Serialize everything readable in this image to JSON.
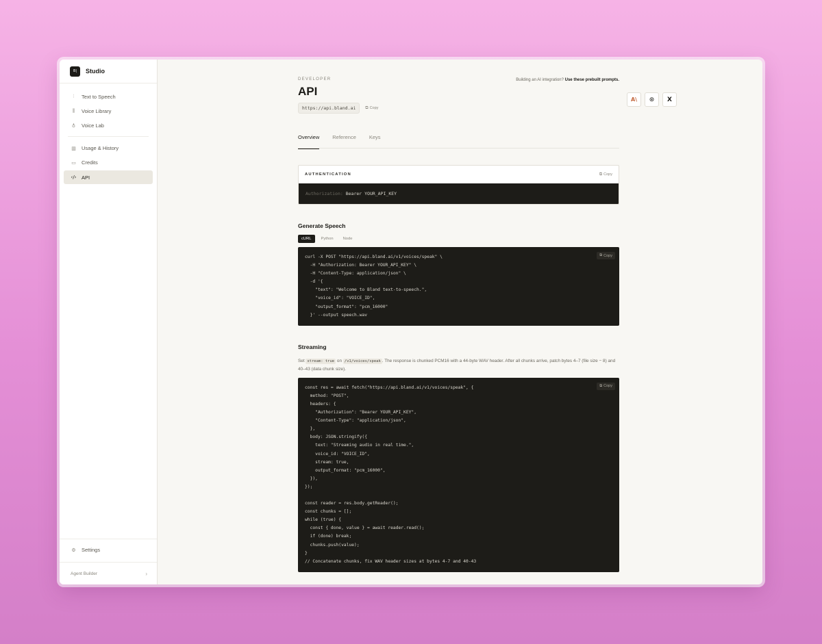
{
  "brand": {
    "name": "Studio",
    "logo_text": "B|"
  },
  "sidebar": {
    "items": [
      {
        "label": "Text to Speech",
        "icon": "waveform-icon"
      },
      {
        "label": "Voice Library",
        "icon": "library-icon"
      },
      {
        "label": "Voice Lab",
        "icon": "mic-icon"
      },
      {
        "label": "Usage & History",
        "icon": "chart-icon"
      },
      {
        "label": "Credits",
        "icon": "card-icon"
      },
      {
        "label": "API",
        "icon": "code-icon"
      }
    ],
    "settings_label": "Settings",
    "agent_builder_label": "Agent Builder"
  },
  "header": {
    "eyebrow": "DEVELOPER",
    "title": "API",
    "base_url": "https://api.bland.ai",
    "copy_label": "Copy"
  },
  "prompts": {
    "text": "Building an AI integration?",
    "link": "Use these prebuilt prompts."
  },
  "tabs": [
    "Overview",
    "Reference",
    "Keys"
  ],
  "auth": {
    "title": "AUTHENTICATION",
    "copy_label": "Copy",
    "key_prefix": "Authorization:",
    "key_value": "Bearer YOUR_API_KEY"
  },
  "generate": {
    "title": "Generate Speech",
    "lang_tabs": [
      "cURL",
      "Python",
      "Node"
    ],
    "copy_label": "Copy",
    "code": "curl -X POST \"https://api.bland.ai/v1/voices/speak\" \\\n  -H \"Authorization: Bearer YOUR_API_KEY\" \\\n  -H \"Content-Type: application/json\" \\\n  -d '{\n    \"text\": \"Welcome to Bland text-to-speech.\",\n    \"voice_id\": \"VOICE_ID\",\n    \"output_format\": \"pcm_16000\"\n  }' --output speech.wav"
  },
  "streaming": {
    "title": "Streaming",
    "desc_1": "Set ",
    "desc_code_1": "stream: true",
    "desc_2": " on ",
    "desc_code_2": "/v1/voices/speak",
    "desc_3": ". The response is chunked PCM16 with a 44-byte WAV header. After all chunks arrive, patch bytes 4–7 (file size − 8) and 40–43 (data chunk size).",
    "copy_label": "Copy",
    "code": "const res = await fetch(\"https://api.bland.ai/v1/voices/speak\", {\n  method: \"POST\",\n  headers: {\n    \"Authorization\": \"Bearer YOUR_API_KEY\",\n    \"Content-Type\": \"application/json\",\n  },\n  body: JSON.stringify({\n    text: \"Streaming audio in real time.\",\n    voice_id: \"VOICE_ID\",\n    stream: true,\n    output_format: \"pcm_16000\",\n  }),\n});\n\nconst reader = res.body.getReader();\nconst chunks = [];\nwhile (true) {\n  const { done, value } = await reader.read();\n  if (done) break;\n  chunks.push(value);\n}\n// Concatenate chunks, fix WAV header sizes at bytes 4-7 and 40-43"
  },
  "colors": {
    "accent": "#1c1b17",
    "anthropic": "#c4683f",
    "code_bg": "#1d1c18"
  }
}
